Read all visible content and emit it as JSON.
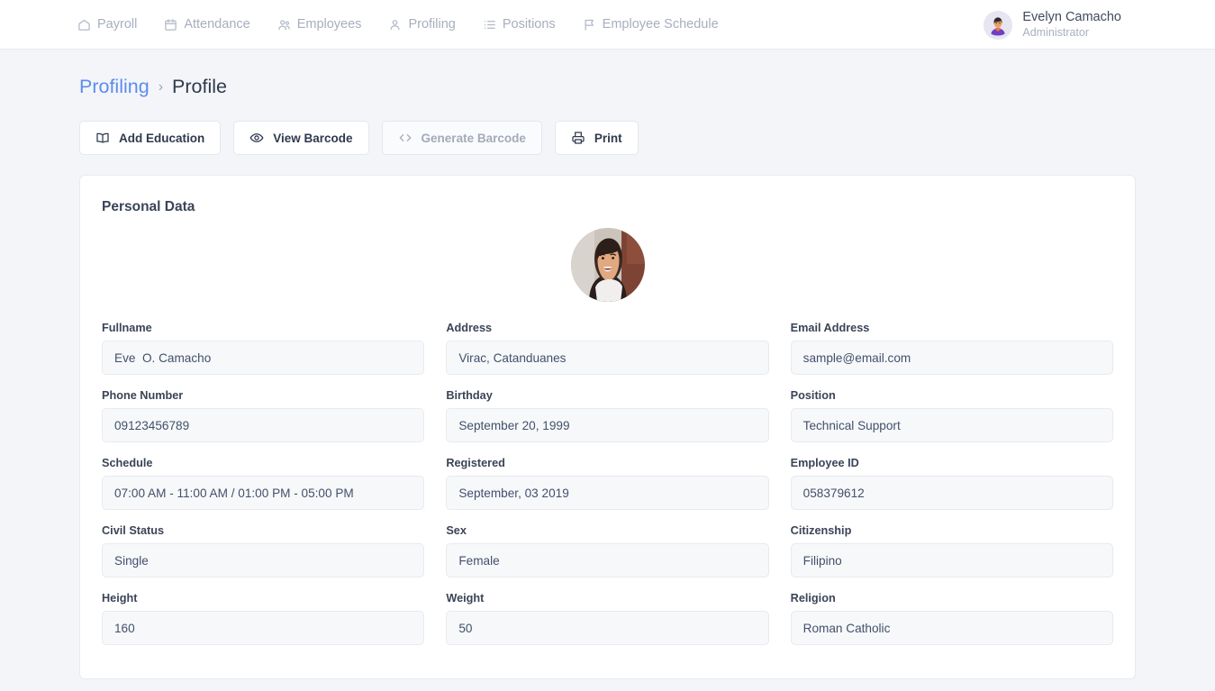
{
  "navbar": {
    "links": [
      {
        "label": "Payroll",
        "icon": "home-icon"
      },
      {
        "label": "Attendance",
        "icon": "calendar-icon"
      },
      {
        "label": "Employees",
        "icon": "users-icon"
      },
      {
        "label": "Profiling",
        "icon": "user-icon"
      },
      {
        "label": "Positions",
        "icon": "list-icon"
      },
      {
        "label": "Employee Schedule",
        "icon": "flag-icon"
      }
    ],
    "user": {
      "name": "Evelyn Camacho",
      "role": "Administrator",
      "avatar": "user-avatar"
    }
  },
  "breadcrumb": {
    "parent": "Profiling",
    "separator": "›",
    "current": "Profile"
  },
  "actions": [
    {
      "label": "Add Education",
      "icon": "book-icon",
      "disabled": false
    },
    {
      "label": "View Barcode",
      "icon": "eye-icon",
      "disabled": false
    },
    {
      "label": "Generate Barcode",
      "icon": "code-icon",
      "disabled": true
    },
    {
      "label": "Print",
      "icon": "printer-icon",
      "disabled": false
    }
  ],
  "card": {
    "title": "Personal Data",
    "photo": "employee-photo",
    "fields": [
      {
        "label": "Fullname",
        "value": "Eve  O. Camacho"
      },
      {
        "label": "Address",
        "value": "Virac, Catanduanes"
      },
      {
        "label": "Email Address",
        "value": "sample@email.com"
      },
      {
        "label": "Phone Number",
        "value": "09123456789"
      },
      {
        "label": "Birthday",
        "value": "September 20, 1999"
      },
      {
        "label": "Position",
        "value": "Technical Support"
      },
      {
        "label": "Schedule",
        "value": "07:00 AM - 11:00 AM / 01:00 PM - 05:00 PM"
      },
      {
        "label": "Registered",
        "value": "September, 03 2019"
      },
      {
        "label": "Employee ID",
        "value": "058379612"
      },
      {
        "label": "Civil Status",
        "value": "Single"
      },
      {
        "label": "Sex",
        "value": "Female"
      },
      {
        "label": "Citizenship",
        "value": "Filipino"
      },
      {
        "label": "Height",
        "value": "160"
      },
      {
        "label": "Weight",
        "value": "50"
      },
      {
        "label": "Religion",
        "value": "Roman Catholic"
      }
    ]
  },
  "colors": {
    "page_background": "#f4f5f9",
    "card_background": "#ffffff",
    "input_background": "#f7f8fa",
    "link": "#5c8ced",
    "text_dark": "#2f3a4d",
    "text_muted": "#a7aec0",
    "border": "#e7eaf0"
  }
}
